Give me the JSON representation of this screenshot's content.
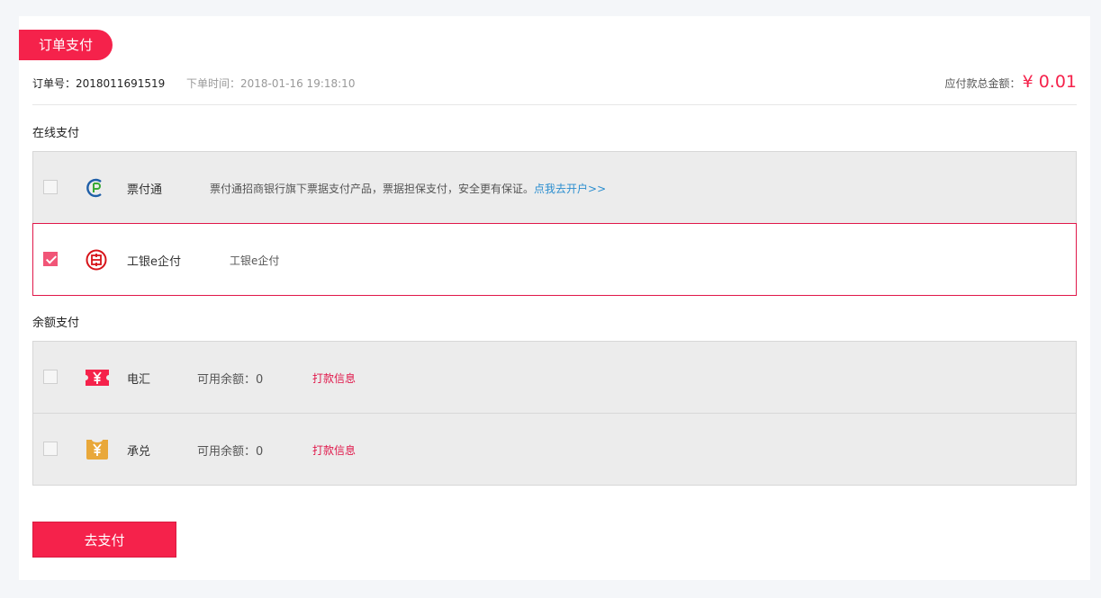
{
  "header": {
    "title": "订单支付"
  },
  "order": {
    "number": "订单号：2018011691519",
    "time": "下单时间：2018-01-16 19:18:10",
    "total_label": "应付款总金额：",
    "total_amount": "¥ 0.01"
  },
  "online": {
    "section_title": "在线支付",
    "methods": [
      {
        "name": "票付通",
        "icon": "pft-logo-icon",
        "description": "票付通招商银行旗下票据支付产品，票据担保支付，安全更有保证。",
        "link": "点我去开户>>",
        "checked": false
      },
      {
        "name": "工银e企付",
        "icon": "icbc-logo-icon",
        "description": "工银e企付",
        "checked": true
      }
    ]
  },
  "balance": {
    "section_title": "余额支付",
    "methods": [
      {
        "name": "电汇",
        "icon": "wire-yen-icon",
        "balance": "可用余额：0",
        "link": "打款信息",
        "checked": false
      },
      {
        "name": "承兑",
        "icon": "acceptance-yen-icon",
        "balance": "可用余额：0",
        "link": "打款信息",
        "checked": false
      }
    ]
  },
  "action": {
    "pay_label": "去支付"
  },
  "colors": {
    "brand": "#f5224b",
    "link_blue": "#2b8ecf",
    "selected_border": "#e0174a",
    "gold": "#e9a83a"
  }
}
